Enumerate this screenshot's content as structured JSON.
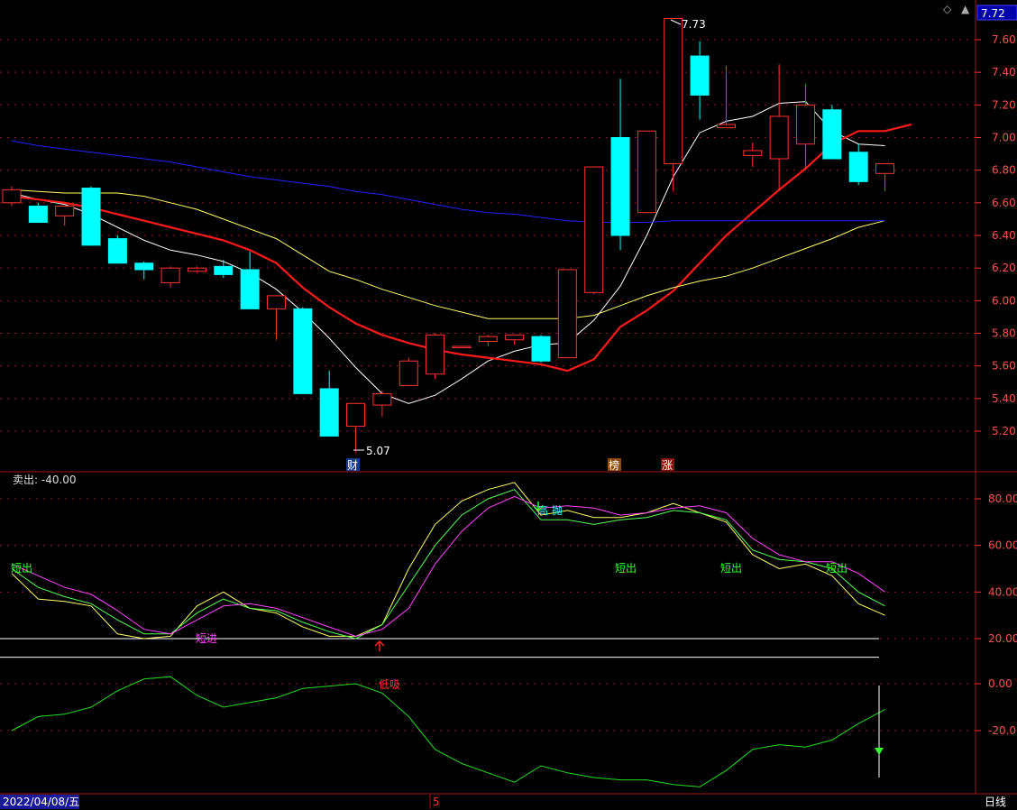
{
  "header": {
    "current_price": "7.72"
  },
  "panel1": {
    "type": "candlestick",
    "y_ticks": [
      "7.60",
      "7.40",
      "7.20",
      "7.00",
      "6.80",
      "6.60",
      "6.40",
      "6.20",
      "6.00",
      "5.80",
      "5.60",
      "5.40",
      "5.20"
    ],
    "ylim": [
      5.0,
      7.76
    ],
    "high_label": "7.73",
    "low_label": "5.07",
    "event_markers": [
      "财",
      "榜",
      "涨"
    ]
  },
  "panel2": {
    "title": "卖出: -40.00",
    "y_ticks": [
      "80.00",
      "60.00",
      "40.00",
      "20.00"
    ],
    "ylim": [
      0,
      90
    ],
    "annotations": [
      "短出",
      "短进",
      "高 抛",
      "短出",
      "短出",
      "短出"
    ]
  },
  "panel3": {
    "y_ticks": [
      "0.00",
      "-20.00"
    ],
    "ylim": [
      -45,
      5
    ],
    "annotations": [
      "低吸"
    ]
  },
  "footer": {
    "date": "2022/04/08/五",
    "month_marker": "5",
    "period": "日线"
  },
  "colors": {
    "up": "#ff3232",
    "down": "#00ffff",
    "ma_white": "#ffffff",
    "ma_red": "#ff1a1a",
    "ma_yellow": "#ffff66",
    "ma_blue": "#2222ff",
    "k_line": "#ffff66",
    "d_line": "#55ff55",
    "j_line": "#ff44ff",
    "panel3_line": "#22dd22",
    "grid": "#8b1a1a"
  },
  "chart_data": [
    {
      "type": "candlestick",
      "ohlc": [
        [
          6.6,
          6.7,
          6.58,
          6.68
        ],
        [
          6.58,
          6.6,
          6.48,
          6.48
        ],
        [
          6.52,
          6.58,
          6.46,
          6.58
        ],
        [
          6.69,
          6.7,
          6.34,
          6.34
        ],
        [
          6.38,
          6.4,
          6.23,
          6.23
        ],
        [
          6.23,
          6.24,
          6.13,
          6.19
        ],
        [
          6.11,
          6.21,
          6.08,
          6.2
        ],
        [
          6.18,
          6.21,
          6.17,
          6.2
        ],
        [
          6.21,
          6.25,
          6.14,
          6.16
        ],
        [
          6.19,
          6.3,
          5.95,
          5.95
        ],
        [
          5.95,
          6.03,
          5.76,
          6.03
        ],
        [
          5.95,
          5.96,
          5.43,
          5.43
        ],
        [
          5.46,
          5.57,
          5.17,
          5.17
        ],
        [
          5.23,
          5.37,
          5.07,
          5.37
        ],
        [
          5.36,
          5.45,
          5.29,
          5.43
        ],
        [
          5.48,
          5.65,
          5.48,
          5.63
        ],
        [
          5.55,
          5.8,
          5.52,
          5.79
        ],
        [
          5.72,
          5.72,
          5.72,
          5.72
        ],
        [
          5.75,
          5.79,
          5.72,
          5.78
        ],
        [
          5.76,
          5.79,
          5.73,
          5.79
        ],
        [
          5.78,
          5.79,
          5.62,
          5.63
        ],
        [
          5.65,
          6.19,
          5.65,
          6.19
        ],
        [
          6.05,
          6.82,
          6.04,
          6.82
        ],
        [
          7.0,
          7.36,
          6.31,
          6.4
        ],
        [
          6.54,
          7.04,
          6.54,
          7.04
        ],
        [
          6.84,
          7.73,
          6.67,
          7.73
        ],
        [
          7.5,
          7.59,
          7.11,
          7.26
        ],
        [
          7.06,
          7.44,
          7.06,
          7.08
        ],
        [
          6.89,
          6.97,
          6.82,
          6.92
        ],
        [
          6.87,
          7.45,
          6.67,
          7.13
        ],
        [
          6.96,
          7.33,
          6.8,
          7.2
        ],
        [
          7.17,
          7.2,
          6.87,
          6.87
        ],
        [
          6.91,
          6.96,
          6.71,
          6.73
        ],
        [
          6.78,
          6.84,
          6.67,
          6.84
        ]
      ],
      "ma": {
        "white": [
          6.66,
          6.62,
          6.59,
          6.53,
          6.45,
          6.37,
          6.31,
          6.28,
          6.24,
          6.17,
          6.07,
          5.93,
          5.77,
          5.59,
          5.43,
          5.37,
          5.42,
          5.52,
          5.63,
          5.69,
          5.73,
          5.74,
          5.88,
          6.09,
          6.4,
          6.76,
          7.03,
          7.1,
          7.13,
          7.21,
          7.22,
          7.04,
          6.96,
          6.95
        ],
        "red": [
          6.64,
          6.62,
          6.6,
          6.57,
          6.53,
          6.49,
          6.45,
          6.41,
          6.37,
          6.31,
          6.23,
          6.08,
          5.96,
          5.86,
          5.79,
          5.74,
          5.7,
          5.67,
          5.65,
          5.63,
          5.61,
          5.57,
          5.64,
          5.84,
          5.94,
          6.06,
          6.23,
          6.4,
          6.54,
          6.68,
          6.81,
          6.96,
          7.04,
          7.04,
          7.08
        ],
        "yellow": [
          6.68,
          6.67,
          6.66,
          6.66,
          6.66,
          6.64,
          6.6,
          6.56,
          6.5,
          6.44,
          6.38,
          6.28,
          6.18,
          6.13,
          6.07,
          6.02,
          5.97,
          5.93,
          5.89,
          5.89,
          5.89,
          5.89,
          5.91,
          5.97,
          6.03,
          6.08,
          6.12,
          6.15,
          6.2,
          6.26,
          6.32,
          6.38,
          6.45,
          6.49
        ],
        "blue": [
          6.98,
          6.95,
          6.93,
          6.91,
          6.89,
          6.87,
          6.85,
          6.82,
          6.79,
          6.76,
          6.74,
          6.72,
          6.7,
          6.67,
          6.65,
          6.62,
          6.59,
          6.56,
          6.54,
          6.53,
          6.51,
          6.49,
          6.48,
          6.48,
          6.48,
          6.49,
          6.49,
          6.49,
          6.49,
          6.49,
          6.49,
          6.49,
          6.49,
          6.49
        ]
      }
    },
    {
      "type": "line",
      "series": [
        {
          "values": [
            48,
            37,
            36,
            34,
            22,
            20,
            21,
            34,
            40,
            33,
            31,
            25,
            21,
            21,
            26,
            50,
            69,
            79,
            84,
            87,
            73,
            75,
            72,
            72,
            74,
            78,
            74,
            70,
            56,
            50,
            52,
            47,
            35,
            30
          ]
        },
        {
          "values": [
            50,
            42,
            38,
            35,
            28,
            22,
            22,
            31,
            37,
            33,
            32,
            27,
            23,
            20,
            26,
            43,
            60,
            73,
            80,
            84,
            71,
            71,
            69,
            71,
            72,
            75,
            74,
            71,
            58,
            54,
            53,
            50,
            40,
            34
          ]
        },
        {
          "values": [
            52,
            47,
            42,
            39,
            32,
            24,
            22,
            28,
            34,
            35,
            33,
            29,
            25,
            21,
            24,
            33,
            52,
            66,
            76,
            81,
            76,
            77,
            76,
            73,
            74,
            76,
            77,
            74,
            63,
            56,
            53,
            53,
            48,
            40
          ]
        }
      ],
      "ref_lines": [
        20,
        12
      ]
    },
    {
      "type": "line",
      "series": [
        {
          "values": [
            -20,
            -14,
            -13,
            -10,
            -3,
            2,
            3,
            -5,
            -10,
            -8,
            -6,
            -2,
            -1,
            0,
            -4,
            -14,
            -28,
            -34,
            -38,
            -42,
            -35,
            -38,
            -40,
            -41,
            -41,
            -43,
            -44,
            -37,
            -28,
            -26,
            -27,
            -24,
            -17,
            -11
          ]
        }
      ]
    }
  ]
}
